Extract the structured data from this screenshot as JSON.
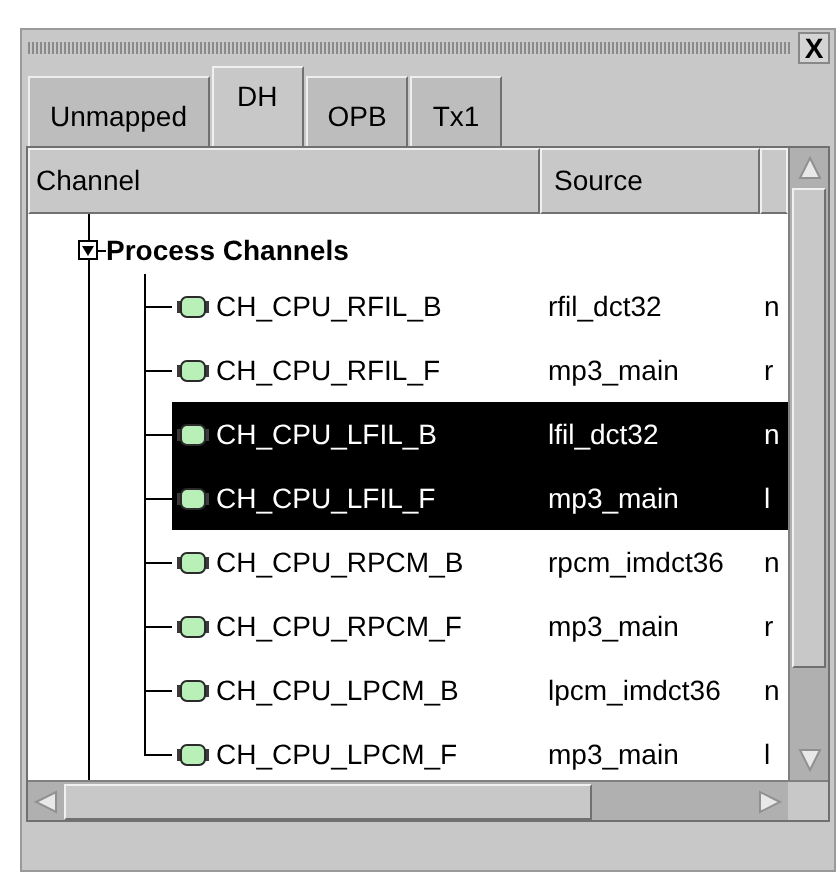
{
  "window": {
    "close_label": "X"
  },
  "tabs": [
    {
      "label": "Unmapped",
      "selected": false
    },
    {
      "label": "DH",
      "selected": true
    },
    {
      "label": "OPB",
      "selected": false
    },
    {
      "label": "Tx1",
      "selected": false
    }
  ],
  "table": {
    "columns": [
      "Channel",
      "Source"
    ],
    "groups": [
      {
        "label": "Process Channels",
        "expanded": true,
        "children": [
          {
            "channel": "CH_CPU_RFIL_B",
            "source": "rfil_dct32",
            "column_3": "n",
            "selected": false
          },
          {
            "channel": "CH_CPU_RFIL_F",
            "source": "mp3_main",
            "column_3": "r",
            "selected": false
          },
          {
            "channel": "CH_CPU_LFIL_B",
            "source": "lfil_dct32",
            "column_3": "n",
            "selected": true
          },
          {
            "channel": "CH_CPU_LFIL_F",
            "source": "mp3_main",
            "column_3": "l",
            "selected": true
          },
          {
            "channel": "CH_CPU_RPCM_B",
            "source": "rpcm_imdct36",
            "column_3": "n",
            "selected": false
          },
          {
            "channel": "CH_CPU_RPCM_F",
            "source": "mp3_main",
            "column_3": "r",
            "selected": false
          },
          {
            "channel": "CH_CPU_LPCM_B",
            "source": "lpcm_imdct36",
            "column_3": "n",
            "selected": false
          },
          {
            "channel": "CH_CPU_LPCM_F",
            "source": "mp3_main",
            "column_3": "l",
            "selected": false
          }
        ]
      }
    ]
  }
}
